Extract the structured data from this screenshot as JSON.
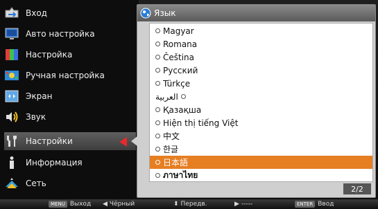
{
  "left_menu": {
    "items": [
      {
        "label": "Вход",
        "icon": "input-icon"
      },
      {
        "label": "Авто настройка",
        "icon": "auto-setup-icon"
      },
      {
        "label": "Настройка",
        "icon": "adjust-icon"
      },
      {
        "label": "Ручная настройка",
        "icon": "manual-setup-icon"
      },
      {
        "label": "Экран",
        "icon": "screen-icon"
      },
      {
        "label": "Звук",
        "icon": "sound-icon"
      },
      {
        "label": "Настройки",
        "icon": "settings-icon",
        "active": true
      },
      {
        "label": "Информация",
        "icon": "info-icon"
      },
      {
        "label": "Сеть",
        "icon": "network-icon"
      }
    ],
    "accent_color": "#e8282c"
  },
  "panel": {
    "title": "Язык",
    "icon": "globe-icon",
    "page_indicator": "2/2",
    "languages": [
      {
        "name": "Magyar"
      },
      {
        "name": "Romana"
      },
      {
        "name": "Čeština"
      },
      {
        "name": "Русский"
      },
      {
        "name": "Türkçe"
      },
      {
        "name": "العربية"
      },
      {
        "name": "Қазақша"
      },
      {
        "name": "Hiện thị tiếng Việt"
      },
      {
        "name": "中文"
      },
      {
        "name": "한글"
      },
      {
        "name": "日本語",
        "selected": true
      },
      {
        "name": "ภาษาไทย"
      }
    ],
    "selected_color": "#e67e22"
  },
  "bottom_bar": {
    "hints": [
      {
        "key": "MENU",
        "label": "Выход"
      },
      {
        "glyph": "◀",
        "label": "Чёрный"
      },
      {
        "glyph": "⬍",
        "label": "Передв."
      },
      {
        "glyph": "▶",
        "label": "-----"
      },
      {
        "key": "ENTER",
        "label": "Ввод"
      }
    ]
  }
}
